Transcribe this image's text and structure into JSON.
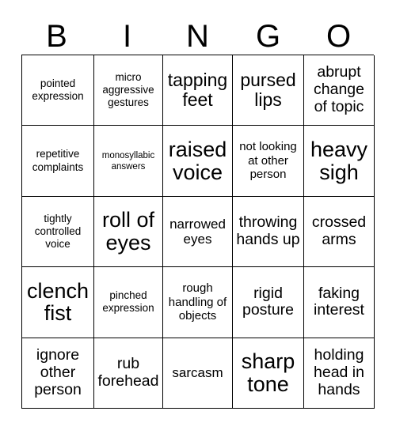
{
  "card": {
    "title": "BINGO",
    "header": {
      "letters": [
        "B",
        "I",
        "N",
        "G",
        "O"
      ]
    },
    "grid": {
      "rows": 5,
      "columns": 5,
      "border_color": "#000000",
      "background_color": "#ffffff",
      "text_color": "#000000",
      "cells": [
        [
          {
            "text": "pointed expression",
            "size": "sm"
          },
          {
            "text": "micro aggressive gestures",
            "size": "sm"
          },
          {
            "text": "tapping feet",
            "size": "2xl"
          },
          {
            "text": "pursed lips",
            "size": "2xl"
          },
          {
            "text": "abrupt change of topic",
            "size": "xl"
          }
        ],
        [
          {
            "text": "repetitive complaints",
            "size": "sm"
          },
          {
            "text": "monosyllabic answers",
            "size": "xs"
          },
          {
            "text": "raised voice",
            "size": "3xl"
          },
          {
            "text": "not looking at other person",
            "size": "md"
          },
          {
            "text": "heavy sigh",
            "size": "3xl"
          }
        ],
        [
          {
            "text": "tightly controlled voice",
            "size": "sm"
          },
          {
            "text": "roll of eyes",
            "size": "3xl"
          },
          {
            "text": "narrowed eyes",
            "size": "lg"
          },
          {
            "text": "throwing hands up",
            "size": "xl"
          },
          {
            "text": "crossed arms",
            "size": "xl"
          }
        ],
        [
          {
            "text": "clench fist",
            "size": "3xl"
          },
          {
            "text": "pinched expression",
            "size": "sm"
          },
          {
            "text": "rough handling of objects",
            "size": "md"
          },
          {
            "text": "rigid posture",
            "size": "xl"
          },
          {
            "text": "faking interest",
            "size": "xl"
          }
        ],
        [
          {
            "text": "ignore other person",
            "size": "xl"
          },
          {
            "text": "rub forehead",
            "size": "xl"
          },
          {
            "text": "sarcasm",
            "size": "lg"
          },
          {
            "text": "sharp tone",
            "size": "3xl"
          },
          {
            "text": "holding head in hands",
            "size": "xl"
          }
        ]
      ]
    }
  }
}
